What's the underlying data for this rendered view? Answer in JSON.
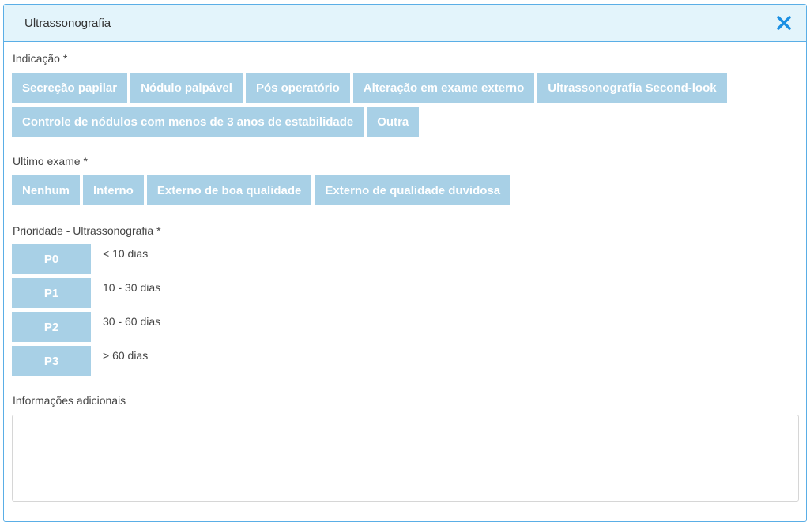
{
  "modal": {
    "title": "Ultrassonografia",
    "close_icon": "close-icon"
  },
  "indicacao": {
    "label": "Indicação *",
    "options_row1": [
      "Secreção papilar",
      "Nódulo palpável",
      "Pós operatório",
      "Alteração em exame externo",
      "Ultrassonografia Second-look"
    ],
    "options_row2": [
      "Controle de nódulos com menos de 3 anos de estabilidade",
      "Outra"
    ]
  },
  "ultimo_exame": {
    "label": "Ultimo exame *",
    "options": [
      "Nenhum",
      "Interno",
      "Externo de boa qualidade",
      "Externo de qualidade duvidosa"
    ]
  },
  "prioridade": {
    "label": "Prioridade - Ultrassonografia *",
    "levels": [
      {
        "code": "P0",
        "desc": "< 10 dias"
      },
      {
        "code": "P1",
        "desc": "10 - 30 dias"
      },
      {
        "code": "P2",
        "desc": "30 - 60 dias"
      },
      {
        "code": "P3",
        "desc": "> 60 dias"
      }
    ]
  },
  "informacoes": {
    "label": "Informações adicionais",
    "value": "",
    "placeholder": ""
  },
  "colors": {
    "accent": "#1a8fe3",
    "button_bg": "#a8d0e6",
    "header_bg": "#e3f4fb",
    "border": "#5aaee6"
  }
}
